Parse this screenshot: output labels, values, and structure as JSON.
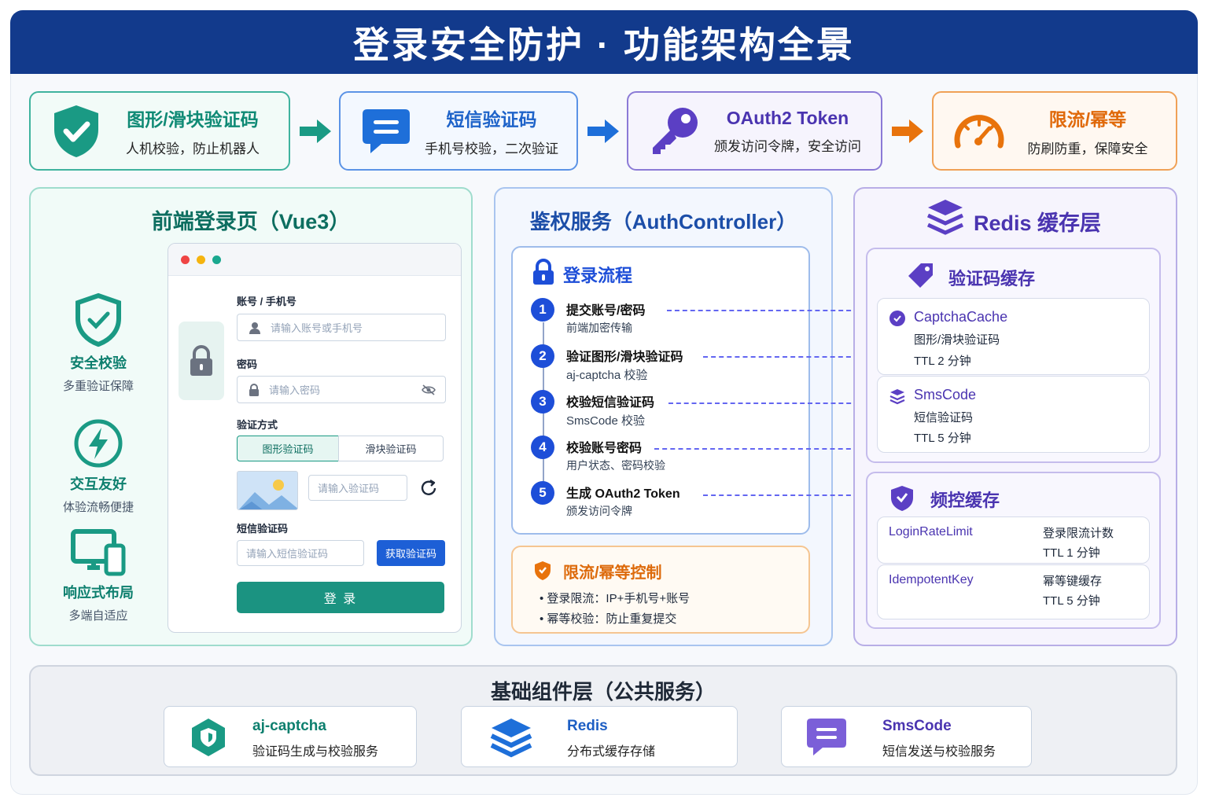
{
  "title": "登录安全防护 · 功能架构全景",
  "flow": [
    {
      "title": "图形/滑块验证码",
      "desc": "人机校验，防止机器人",
      "icon": "shield-check-icon",
      "color": "#1a9a84"
    },
    {
      "title": "短信验证码",
      "desc": "手机号校验，二次验证",
      "icon": "message-icon",
      "color": "#1e6fd9"
    },
    {
      "title": "OAuth2 Token",
      "desc": "颁发访问令牌，安全访问",
      "icon": "key-icon",
      "color": "#5b3fc4"
    },
    {
      "title": "限流/幂等",
      "desc": "防刷防重，保障安全",
      "icon": "speedometer-icon",
      "color": "#e8730c"
    }
  ],
  "frontend": {
    "title": "前端登录页（Vue3）",
    "features": [
      {
        "title": "安全校验",
        "desc": "多重验证保障",
        "icon": "shield-icon"
      },
      {
        "title": "交互友好",
        "desc": "体验流畅便捷",
        "icon": "lightning-icon"
      },
      {
        "title": "响应式布局",
        "desc": "多端自适应",
        "icon": "devices-icon"
      }
    ],
    "form": {
      "account_label": "账号 / 手机号",
      "account_placeholder": "请输入账号或手机号",
      "password_label": "密码",
      "password_placeholder": "请输入密码",
      "verify_label": "验证方式",
      "tab_graphic": "图形验证码",
      "tab_slider": "滑块验证码",
      "captcha_placeholder": "请输入验证码",
      "sms_label": "短信验证码",
      "sms_placeholder": "请输入短信验证码",
      "sms_button": "获取验证码",
      "login_button": "登 录"
    }
  },
  "auth": {
    "title": "鉴权服务（AuthController）",
    "flow_title": "登录流程",
    "steps": [
      {
        "num": "1",
        "title": "提交账号/密码",
        "desc": "前端加密传输"
      },
      {
        "num": "2",
        "title": "验证图形/滑块验证码",
        "desc": "aj-captcha 校验"
      },
      {
        "num": "3",
        "title": "校验短信验证码",
        "desc": "SmsCode 校验"
      },
      {
        "num": "4",
        "title": "校验账号密码",
        "desc": "用户状态、密码校验"
      },
      {
        "num": "5",
        "title": "生成 OAuth2 Token",
        "desc": "颁发访问令牌"
      }
    ],
    "rate_title": "限流/幂等控制",
    "rate_items": [
      "登录限流：IP+手机号+账号",
      "幂等校验：防止重复提交"
    ]
  },
  "redis": {
    "title": "Redis 缓存层",
    "captcha_section": "验证码缓存",
    "captcha_items": [
      {
        "name": "CaptchaCache",
        "desc": "图形/滑块验证码",
        "ttl": "TTL 2 分钟"
      },
      {
        "name": "SmsCode",
        "desc": "短信验证码",
        "ttl": "TTL 5 分钟"
      }
    ],
    "freq_section": "频控缓存",
    "freq_items": [
      {
        "name": "LoginRateLimit",
        "desc": "登录限流计数",
        "ttl": "TTL 1 分钟"
      },
      {
        "name": "IdempotentKey",
        "desc": "幂等键缓存",
        "ttl": "TTL 5 分钟"
      }
    ]
  },
  "base": {
    "title": "基础组件层（公共服务）",
    "components": [
      {
        "name": "aj-captcha",
        "desc": "验证码生成与校验服务",
        "icon": "shield-icon"
      },
      {
        "name": "Redis",
        "desc": "分布式缓存存储",
        "icon": "layers-icon"
      },
      {
        "name": "SmsCode",
        "desc": "短信发送与校验服务",
        "icon": "message-icon"
      }
    ]
  }
}
